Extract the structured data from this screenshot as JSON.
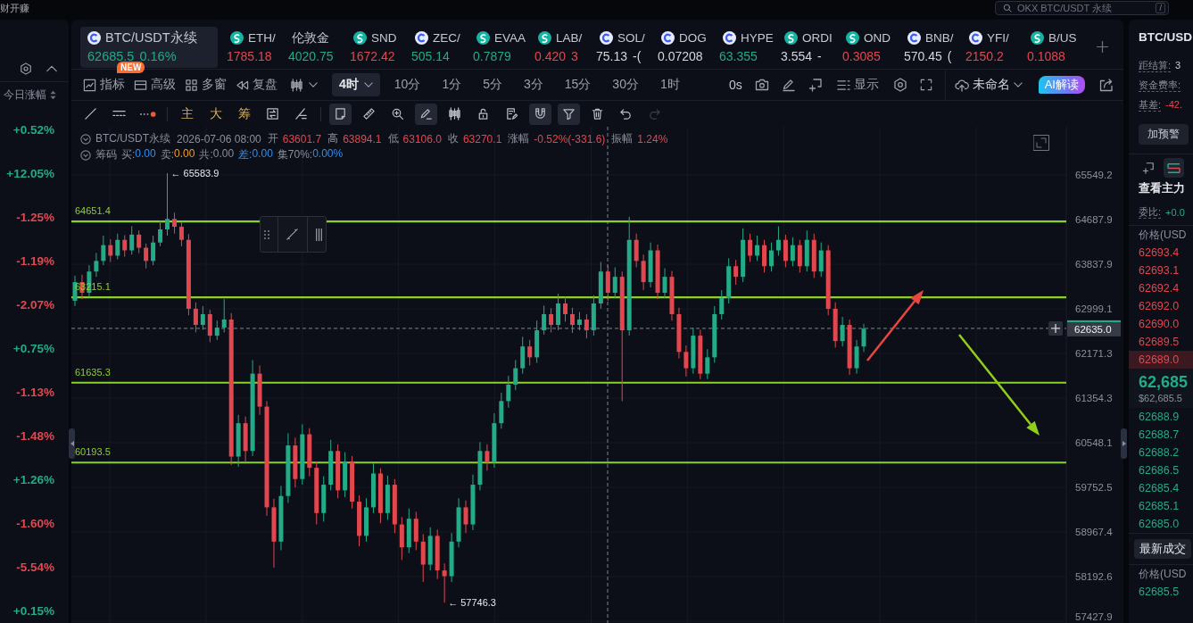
{
  "top_bar": {
    "promo_text": "财开赚",
    "search": {
      "placeholder": "OKX BTC/USDT 永续",
      "shortcut": "/"
    }
  },
  "sidebar": {
    "sort_label": "今日涨幅",
    "changes": [
      {
        "value": "+0.52%",
        "color": "#22ab86"
      },
      {
        "value": "+12.05%",
        "color": "#22ab86"
      },
      {
        "value": "-1.25%",
        "color": "#e2474f"
      },
      {
        "value": "-1.19%",
        "color": "#e2474f"
      },
      {
        "value": "-2.07%",
        "color": "#e2474f"
      },
      {
        "value": "+0.75%",
        "color": "#22ab86"
      },
      {
        "value": "-1.13%",
        "color": "#e2474f"
      },
      {
        "value": "-1.48%",
        "color": "#e2474f"
      },
      {
        "value": "+1.26%",
        "color": "#22ab86"
      },
      {
        "value": "-1.60%",
        "color": "#e2474f"
      },
      {
        "value": "-5.54%",
        "color": "#e2474f"
      },
      {
        "value": "+0.15%",
        "color": "#22ab86"
      }
    ]
  },
  "tickers": {
    "items": [
      {
        "name": "BTC/USDT永续",
        "price": "62685.5",
        "change": "0.16%",
        "kind": "ring",
        "color": "#22ab86",
        "selected": true
      },
      {
        "name": "ETH/",
        "price": "1785.18",
        "kind": "swirl",
        "color": "#e2474f",
        "selected": false
      },
      {
        "name": "伦敦金",
        "price": "4020.75",
        "kind": "plain",
        "color": "#22ab86",
        "selected": false
      },
      {
        "name": "SND",
        "price": "1672.42",
        "kind": "swirl",
        "color": "#e2474f",
        "selected": false
      },
      {
        "name": "ZEC/",
        "price": "505.14",
        "kind": "ring",
        "color": "#22ab86",
        "selected": false
      },
      {
        "name": "EVAA",
        "price": "0.7879",
        "kind": "swirl",
        "color": "#22ab86",
        "selected": false
      },
      {
        "name": "LAB/",
        "price": "0.420",
        "change": "3",
        "kind": "swirl",
        "color": "#e2474f",
        "selected": false
      },
      {
        "name": "SOL/",
        "price": "75.13",
        "change": "-(",
        "kind": "ring",
        "color": "#d3d6dc",
        "selected": false
      },
      {
        "name": "DOG",
        "price": "0.07208",
        "kind": "ring",
        "color": "#d3d6dc",
        "selected": false
      },
      {
        "name": "HYPE",
        "price": "63.355",
        "kind": "ring",
        "color": "#22ab86",
        "selected": false
      },
      {
        "name": "ORDI",
        "price": "3.554",
        "change": "-",
        "kind": "swirl",
        "color": "#d3d6dc",
        "selected": false
      },
      {
        "name": "OND",
        "price": "0.3085",
        "kind": "swirl",
        "color": "#e2474f",
        "selected": false
      },
      {
        "name": "BNB/",
        "price": "570.45",
        "change": "(",
        "kind": "ring",
        "color": "#d3d6dc",
        "selected": false
      },
      {
        "name": "YFI/",
        "price": "2150.2",
        "kind": "ring",
        "color": "#e2474f",
        "selected": false
      },
      {
        "name": "B/US",
        "price": "0.1088",
        "kind": "swirl",
        "color": "#e2474f",
        "selected": false
      }
    ]
  },
  "toolbar": {
    "tools": [
      {
        "label": "指标",
        "badge": "NEW"
      },
      {
        "label": "高级"
      },
      {
        "label": "多窗"
      },
      {
        "label": "复盘"
      }
    ],
    "intervals": [
      {
        "label": "4时",
        "selected": true
      },
      {
        "label": "10分",
        "selected": false
      },
      {
        "label": "1分",
        "selected": false
      },
      {
        "label": "5分",
        "selected": false
      },
      {
        "label": "3分",
        "selected": false
      },
      {
        "label": "15分",
        "selected": false
      },
      {
        "label": "30分",
        "selected": false
      },
      {
        "label": "1时",
        "selected": false
      }
    ],
    "countdown": "0s",
    "display": "显示",
    "layout": "未命名",
    "ai": "AI解读"
  },
  "drawing_toolbar": {
    "indicators": [
      "主",
      "大",
      "筹"
    ],
    "tools": [
      {
        "active": true,
        "disabled": false
      },
      {
        "active": false,
        "disabled": false
      },
      {
        "active": false,
        "disabled": false
      },
      {
        "active": true,
        "disabled": false
      },
      {
        "active": false,
        "disabled": false
      },
      {
        "active": false,
        "disabled": false
      },
      {
        "active": false,
        "disabled": false
      },
      {
        "active": true,
        "disabled": false
      },
      {
        "active": true,
        "disabled": false
      },
      {
        "active": false,
        "disabled": false
      },
      {
        "active": false,
        "disabled": false
      },
      {
        "active": false,
        "disabled": true
      }
    ]
  },
  "chart": {
    "legend": {
      "symbol": "BTC/USDT永续",
      "time": "2026-07-06 08:00",
      "color": "#e2474f",
      "fields": [
        {
          "label": "开",
          "value": "63601.7"
        },
        {
          "label": "高",
          "value": "63894.1"
        },
        {
          "label": "低",
          "value": "63106.0"
        },
        {
          "label": "收",
          "value": "63270.1"
        },
        {
          "label": "涨幅",
          "value": "-0.52%(-331.6)"
        },
        {
          "label": "振幅",
          "value": "1.24%"
        }
      ]
    },
    "chips": {
      "title": "筹码",
      "fields": [
        {
          "label": "买:",
          "value": "0.00",
          "color": "#2e8ff0",
          "label_colored": false
        },
        {
          "label": "卖:",
          "value": "0.00",
          "color": "#f0a020",
          "label_colored": false
        },
        {
          "label": "共:",
          "value": "0.00",
          "color": "#8a8f9b",
          "label_colored": false
        },
        {
          "label": "差:",
          "value": "0.00",
          "color": "#2e8ff0",
          "label_colored": true
        },
        {
          "label": "集70%:",
          "value": "0.00%",
          "color": "#2e8ff0",
          "label_colored": false
        }
      ]
    },
    "chart_data": [
      {
        "type": "candlestick",
        "log": true,
        "grid": true,
        "ylim": [
          57398.5,
          66492.3
        ],
        "yticks": [
          65549.2,
          64687.9,
          63837.9,
          62999.1,
          62171.3,
          61354.3,
          60548.1,
          59752.5,
          58967.4,
          58192.6,
          57427.9
        ],
        "categories": [
          null,
          null,
          null,
          null,
          null,
          null,
          null,
          null,
          null,
          null,
          null,
          null,
          null,
          null,
          null,
          null,
          null,
          null,
          null,
          null,
          null,
          null,
          null,
          null,
          null,
          null,
          null,
          null,
          null,
          null,
          null,
          null,
          null,
          null,
          null,
          null,
          null,
          null,
          null,
          null,
          null,
          null,
          null,
          null,
          null,
          null,
          null,
          null,
          null,
          null,
          null,
          null,
          null,
          null,
          null,
          null,
          null,
          null,
          null,
          null,
          null,
          null,
          null,
          null,
          null,
          null,
          null,
          null,
          null,
          null,
          null,
          null,
          null,
          null,
          null,
          null,
          null,
          null,
          null,
          null,
          null,
          null,
          null,
          null,
          null,
          null,
          null,
          null,
          null,
          null,
          null,
          null,
          null,
          null,
          null,
          null,
          null,
          null,
          null,
          null,
          null,
          null,
          null,
          null,
          null,
          null,
          null,
          null,
          null,
          null,
          null,
          null,
          null,
          null,
          null,
          null,
          null,
          null,
          null,
          null,
          null,
          null,
          null,
          null,
          null,
          null,
          null,
          null,
          null,
          null,
          null,
          null,
          null,
          null,
          null,
          null,
          null,
          null,
          null,
          null
        ],
        "ohlc": [
          [
            63150,
            63620,
            63050,
            63500
          ],
          [
            63500,
            63640,
            63180,
            63300
          ],
          [
            63300,
            63820,
            63220,
            63700
          ],
          [
            63700,
            64050,
            63600,
            63900
          ],
          [
            63900,
            64380,
            63820,
            64200
          ],
          [
            64200,
            64310,
            63880,
            64000
          ],
          [
            64000,
            64420,
            63930,
            64300
          ],
          [
            64300,
            64390,
            63980,
            64100
          ],
          [
            64100,
            64560,
            64020,
            64400
          ],
          [
            64400,
            64480,
            64050,
            64150
          ],
          [
            64150,
            64230,
            63760,
            63900
          ],
          [
            63900,
            64380,
            63820,
            64250
          ],
          [
            64250,
            64660,
            64180,
            64500
          ],
          [
            64500,
            65583.9,
            64380,
            64700
          ],
          [
            64700,
            64820,
            64420,
            64550
          ],
          [
            64550,
            64640,
            64180,
            64300
          ],
          [
            64300,
            64410,
            62880,
            63000
          ],
          [
            63000,
            63120,
            62560,
            62700
          ],
          [
            62700,
            63050,
            62610,
            62900
          ],
          [
            62900,
            62980,
            62380,
            62500
          ],
          [
            62500,
            62780,
            62420,
            62650
          ],
          [
            62650,
            63180,
            62560,
            62800
          ],
          [
            62800,
            62920,
            60150,
            60300
          ],
          [
            60300,
            61050,
            60120,
            60900
          ],
          [
            60900,
            61020,
            60200,
            60400
          ],
          [
            60400,
            62050,
            60310,
            61800
          ],
          [
            61800,
            61950,
            61050,
            61200
          ],
          [
            61200,
            61300,
            59250,
            59400
          ],
          [
            59400,
            59550,
            58350,
            58800
          ],
          [
            58800,
            59780,
            58650,
            59600
          ],
          [
            59600,
            60720,
            59480,
            60500
          ],
          [
            60500,
            60640,
            59750,
            59900
          ],
          [
            59900,
            60880,
            59800,
            60700
          ],
          [
            60700,
            60810,
            59950,
            60100
          ],
          [
            60100,
            60200,
            59100,
            59300
          ],
          [
            59300,
            59950,
            59150,
            59800
          ],
          [
            59800,
            60600,
            59700,
            60400
          ],
          [
            60400,
            60520,
            59560,
            59700
          ],
          [
            59700,
            60380,
            59580,
            60200
          ],
          [
            60200,
            60310,
            59380,
            59500
          ],
          [
            59500,
            59610,
            58720,
            58900
          ],
          [
            58900,
            59560,
            58800,
            59400
          ],
          [
            59400,
            60180,
            59300,
            60000
          ],
          [
            60000,
            60090,
            59120,
            59300
          ],
          [
            59300,
            59960,
            59180,
            59800
          ],
          [
            59800,
            59900,
            58950,
            59100
          ],
          [
            59100,
            59230,
            58480,
            58700
          ],
          [
            58700,
            59380,
            58600,
            59200
          ],
          [
            59200,
            59320,
            58650,
            58800
          ],
          [
            58800,
            58930,
            58100,
            58400
          ],
          [
            58400,
            59050,
            58300,
            58900
          ],
          [
            58900,
            59010,
            58150,
            58300
          ],
          [
            58300,
            58420,
            57746.3,
            58200
          ],
          [
            58200,
            58950,
            58100,
            58800
          ],
          [
            58800,
            59560,
            58700,
            59400
          ],
          [
            59400,
            59520,
            58950,
            59100
          ],
          [
            59100,
            59980,
            59000,
            59800
          ],
          [
            59800,
            60560,
            59700,
            60400
          ],
          [
            60400,
            60520,
            60050,
            60200
          ],
          [
            60200,
            61080,
            60100,
            60900
          ],
          [
            60900,
            61450,
            60800,
            61300
          ],
          [
            61300,
            61760,
            61180,
            61600
          ],
          [
            61600,
            62050,
            61500,
            61900
          ],
          [
            61900,
            62480,
            61800,
            62300
          ],
          [
            62300,
            62420,
            61950,
            62100
          ],
          [
            62100,
            62780,
            62000,
            62600
          ],
          [
            62600,
            63060,
            62520,
            62900
          ],
          [
            62900,
            63010,
            62560,
            62700
          ],
          [
            62700,
            63280,
            62600,
            63100
          ],
          [
            63100,
            63220,
            62760,
            62900
          ],
          [
            62900,
            63020,
            62550,
            62700
          ],
          [
            62700,
            62940,
            62600,
            62800
          ],
          [
            62800,
            62900,
            62450,
            62600
          ],
          [
            62600,
            63250,
            62500,
            63100
          ],
          [
            63100,
            63880,
            63000,
            63700
          ],
          [
            63700,
            63820,
            63150,
            63300
          ],
          [
            63300,
            63780,
            63200,
            63600
          ],
          [
            63600,
            63700,
            61300,
            62600
          ],
          [
            62600,
            64740,
            62500,
            64300
          ],
          [
            64300,
            64420,
            63780,
            63900
          ],
          [
            63900,
            64020,
            63350,
            63500
          ],
          [
            63500,
            64250,
            63400,
            64100
          ],
          [
            64100,
            64210,
            63180,
            63300
          ],
          [
            63300,
            63760,
            63200,
            63600
          ],
          [
            63600,
            63710,
            62780,
            62900
          ],
          [
            62900,
            63020,
            62080,
            62200
          ],
          [
            62200,
            62320,
            61750,
            61900
          ],
          [
            61900,
            62650,
            61800,
            62500
          ],
          [
            62500,
            62610,
            61700,
            61800
          ],
          [
            61800,
            62250,
            61700,
            62100
          ],
          [
            62100,
            63050,
            62000,
            62900
          ],
          [
            62900,
            63350,
            62800,
            63200
          ],
          [
            63200,
            63950,
            63100,
            63800
          ],
          [
            63800,
            63920,
            63450,
            63600
          ],
          [
            63600,
            64520,
            63500,
            64300
          ],
          [
            64300,
            64420,
            63880,
            64000
          ],
          [
            64000,
            64380,
            63900,
            64200
          ],
          [
            64200,
            64300,
            63680,
            63800
          ],
          [
            63800,
            64250,
            63700,
            64100
          ],
          [
            64100,
            64560,
            64000,
            64300
          ],
          [
            64300,
            64400,
            63780,
            63900
          ],
          [
            63900,
            64350,
            63800,
            64200
          ],
          [
            64200,
            64300,
            63680,
            63800
          ],
          [
            63800,
            64480,
            63700,
            64300
          ],
          [
            64300,
            64420,
            63580,
            63700
          ],
          [
            63700,
            64250,
            63600,
            64100
          ],
          [
            64100,
            64200,
            62880,
            63000
          ],
          [
            63000,
            63120,
            62280,
            62400
          ],
          [
            62400,
            62850,
            62300,
            62700
          ],
          [
            62700,
            62800,
            61780,
            61900
          ],
          [
            61900,
            62420,
            61800,
            62300
          ],
          [
            62300,
            62720,
            62200,
            62630
          ],
          null,
          null,
          null,
          null,
          null,
          null,
          null,
          null,
          null,
          null,
          null,
          null,
          null,
          null,
          null,
          null,
          null,
          null,
          null,
          null,
          null,
          null,
          null,
          null,
          null,
          null,
          null,
          null
        ],
        "ref_lines": [
          {
            "axis": "y",
            "value": 64651.4,
            "label": "64651.4",
            "color": "#8bd12c",
            "line_style": "solid"
          },
          {
            "axis": "y",
            "value": 63215.1,
            "label": "63215.1",
            "color": "#8bd12c",
            "line_style": "solid"
          },
          {
            "axis": "y",
            "value": 61635.3,
            "label": "61635.3",
            "color": "#8bd12c",
            "line_style": "solid"
          },
          {
            "axis": "y",
            "value": 60193.5,
            "label": "60193.5",
            "color": "#8bd12c",
            "line_style": "solid"
          },
          {
            "axis": "y",
            "value": 62635,
            "label": "62635.0",
            "color": "#7d828d",
            "line_style": "dashed"
          }
        ],
        "annotations": [
          "← 65583.9",
          "← 57746.3"
        ]
      }
    ]
  },
  "contract_panel": {
    "title": "BTC/USD",
    "settlement": {
      "label": "距结算:",
      "value": "3"
    },
    "funding_label": "资金费率:",
    "basis": {
      "label": "基差:",
      "value": "-42."
    },
    "alert_button": "加预警",
    "view_tabs": [
      {
        "selected": false
      },
      {
        "selected": true
      }
    ]
  },
  "order_book": {
    "title": "查看主力",
    "ratio": {
      "label": "委比:",
      "value": "+0.0"
    },
    "price_header": "价格(USD",
    "asks": [
      {
        "price": "62693.4",
        "highlighted": false
      },
      {
        "price": "62693.1",
        "highlighted": false
      },
      {
        "price": "62692.4",
        "highlighted": false
      },
      {
        "price": "62692.0",
        "highlighted": false
      },
      {
        "price": "62690.0",
        "highlighted": false
      },
      {
        "price": "62689.5",
        "highlighted": false
      },
      {
        "price": "62689.0",
        "highlighted": true
      }
    ],
    "last_price": "62,685",
    "last_price_usd": "$62,685.5",
    "bids": [
      "62688.9",
      "62688.7",
      "62688.2",
      "62686.5",
      "62685.4",
      "62685.1",
      "62685.0"
    ]
  },
  "trades": {
    "tab": "最新成交",
    "price_header": "价格(USD",
    "rows": [
      "62685.5"
    ]
  }
}
